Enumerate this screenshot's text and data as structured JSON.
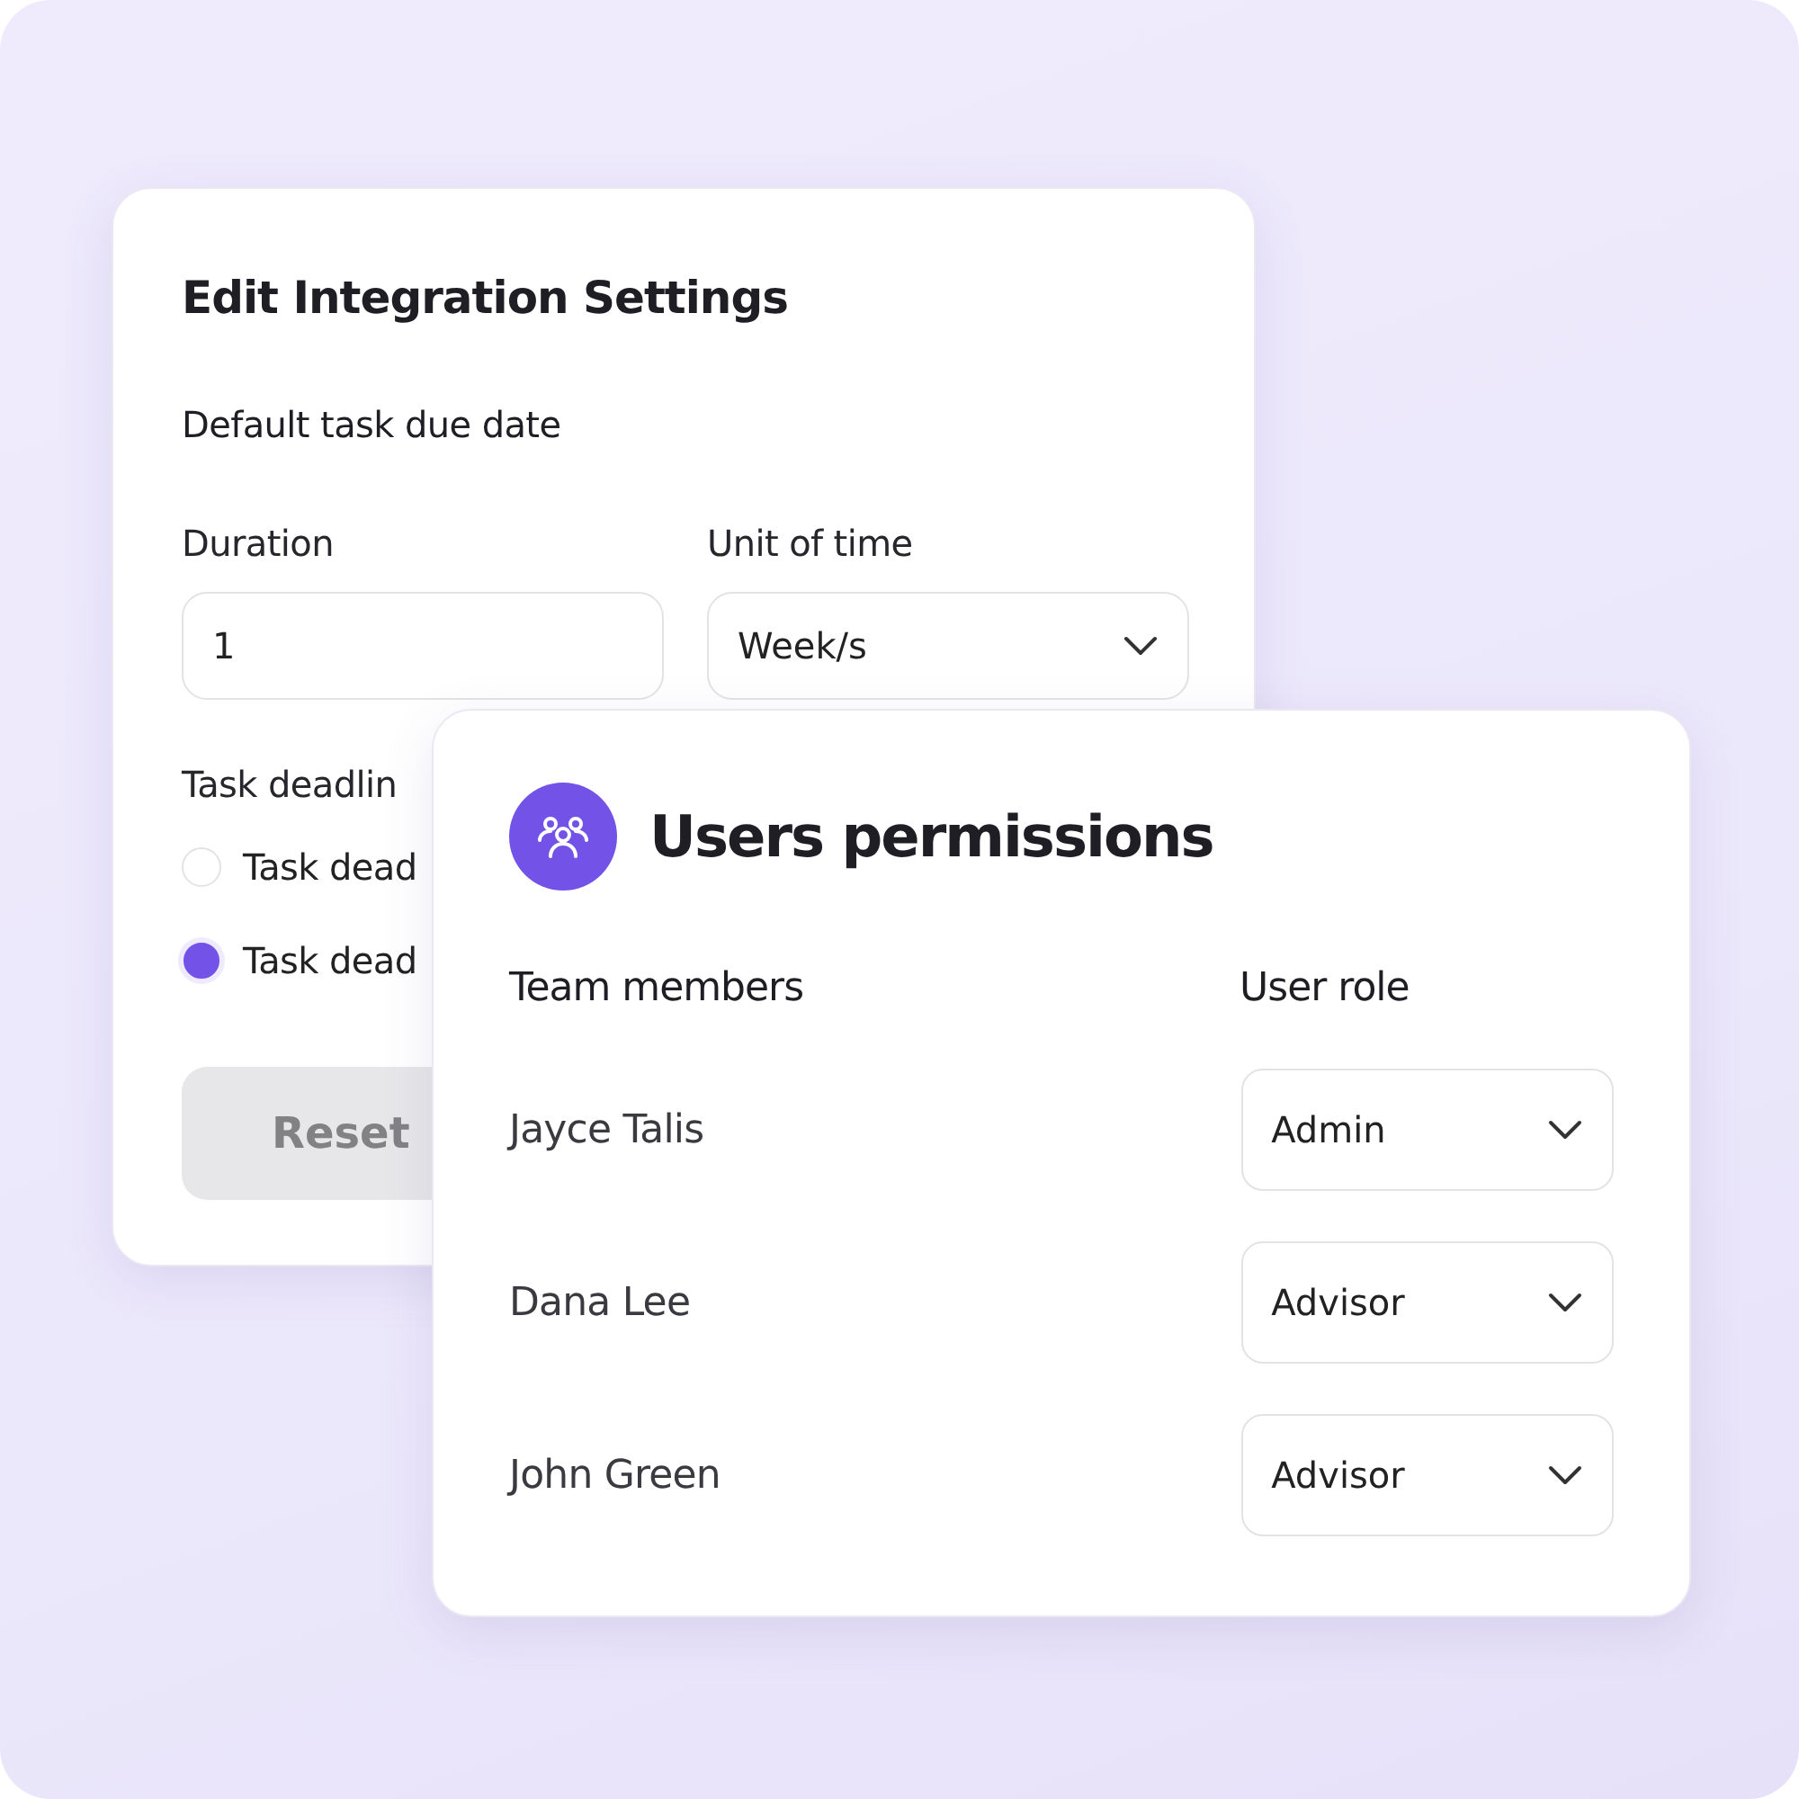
{
  "integration_card": {
    "title": "Edit Integration Settings",
    "section_title": "Default task due date",
    "fields": [
      {
        "label": "Duration",
        "kind": "text",
        "value": "1"
      },
      {
        "label": "Unit of time",
        "kind": "select",
        "value": "Week/s"
      }
    ],
    "deadline_label": "Task deadlin",
    "radios": [
      {
        "label": "Task dead",
        "selected": false
      },
      {
        "label": "Task dead",
        "selected": true
      }
    ],
    "reset_button": "Reset"
  },
  "permissions_card": {
    "title": "Users permissions",
    "columns": [
      "Team members",
      "User role"
    ],
    "rows": [
      {
        "name": "Jayce Talis",
        "role": "Admin"
      },
      {
        "name": "Dana Lee",
        "role": "Advisor"
      },
      {
        "name": "John Green",
        "role": "Advisor"
      }
    ]
  }
}
